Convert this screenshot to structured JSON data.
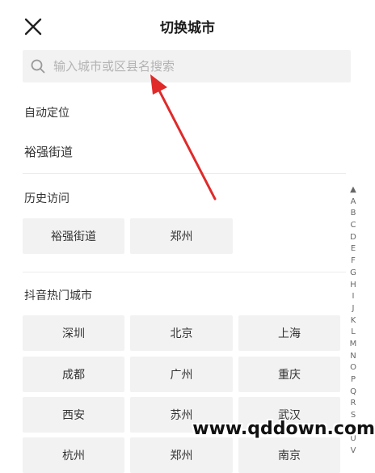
{
  "header": {
    "title": "切换城市"
  },
  "search": {
    "placeholder": "输入城市或区县名搜索"
  },
  "auto_location": {
    "title": "自动定位",
    "city": "裕强街道"
  },
  "history": {
    "title": "历史访问",
    "items": [
      "裕强街道",
      "郑州"
    ]
  },
  "hot": {
    "title": "抖音热门城市",
    "cities": [
      "深圳",
      "北京",
      "上海",
      "成都",
      "广州",
      "重庆",
      "西安",
      "苏州",
      "武汉",
      "杭州",
      "郑州",
      "南京"
    ]
  },
  "index_bar": [
    "▲",
    "A",
    "B",
    "C",
    "D",
    "E",
    "F",
    "G",
    "H",
    "I",
    "J",
    "K",
    "L",
    "M",
    "N",
    "O",
    "P",
    "Q",
    "R",
    "S",
    "T",
    "U",
    "V"
  ],
  "watermark": "www.qddown.com",
  "annotation_color": "#e02a2a"
}
